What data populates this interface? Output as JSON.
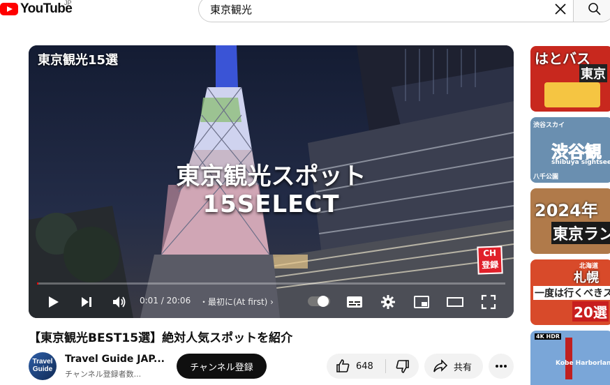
{
  "header": {
    "logo_text": "YouTube",
    "country": "JP",
    "search_value": "東京観光",
    "clear_icon": "close-icon",
    "search_icon": "search-icon"
  },
  "player": {
    "overlay_title": "東京観光15選",
    "caption_line1": "東京観光スポット",
    "caption_line2": "15SELECT",
    "badge_line1": "CH",
    "badge_line2": "登録",
    "time": "0:01 / 20:06",
    "chapter": "・最初に(At first) ›",
    "progress": 0.001
  },
  "video": {
    "title": "【東京観光BEST15選】絶対人気スポットを紹介",
    "channel_name": "Travel Guide JAP...",
    "avatar_line1": "Travel",
    "avatar_line2": "Guide",
    "subscriber_text": "チャンネル登録者数...",
    "subscribe_label": "チャンネル登録",
    "like_count": "648",
    "share_label": "共有"
  },
  "sidebar": {
    "thumbs": [
      {
        "text1": "はとバス",
        "text2": "東京",
        "bg": "#c8281e"
      },
      {
        "text1": "渋谷スカイ",
        "text2": "渋谷観",
        "text3": "shibuya sightsee",
        "text4": "八千公園",
        "bg": "#6a8fb0"
      },
      {
        "text1": "2024年",
        "text2": "東京ラン",
        "bg": "#b07a4a"
      },
      {
        "text1": "北海道",
        "text2": "札幌",
        "text3": "一度は行くべきス",
        "text4": "20選",
        "bg": "#d84a2a"
      },
      {
        "text1": "4K HDR",
        "text2": "Kobe Harborland S",
        "bg": "#7aa6d8"
      }
    ]
  },
  "colors": {
    "brand_red": "#ff0000",
    "subscribe_bg": "#0f0f0f",
    "pill_bg": "#f2f2f2"
  }
}
